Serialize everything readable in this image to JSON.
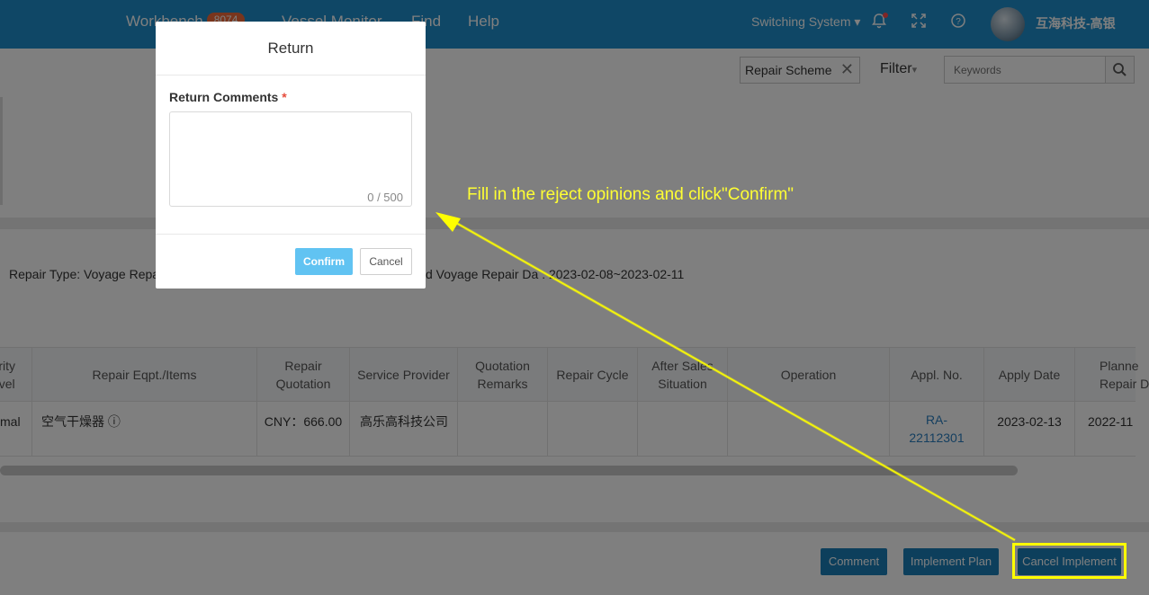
{
  "header": {
    "nav": [
      {
        "label": "Workbench",
        "badge": "8074"
      },
      {
        "label": "Vessel Monitor"
      },
      {
        "label": "Find"
      },
      {
        "label": "Help"
      }
    ],
    "switch_label": "Switching System",
    "user_name": "互海科技-高银",
    "icons": [
      "bell-icon",
      "fullscreen-icon",
      "help-icon"
    ]
  },
  "toolbar": {
    "tag_label": "Repair Scheme",
    "filter_label": "Filter",
    "search_placeholder": "Keywords"
  },
  "summary": {
    "repair_type": "Repair Type: Voyage Repa",
    "planned_date": "d Voyage Repair Da  : 2023-02-08~2023-02-11"
  },
  "table": {
    "headers": [
      "rity\nvel",
      "Repair Eqpt./Items",
      "Repair\nQuotation",
      "Service Provider",
      "Quotation\nRemarks",
      "Repair Cycle",
      "After Sales\nSituation",
      "Operation",
      "Appl. No.",
      "Apply Date",
      "Planne\nRepair D"
    ],
    "rows": [
      {
        "level": "mal",
        "item": "空气干燥器 ⓘ",
        "quotation": "CNY：666.00",
        "provider": "高乐高科技公司",
        "remarks": "",
        "cycle": "",
        "after_sales": "",
        "operation": "",
        "appl_no": "RA-\n22112301",
        "apply_date": "2023-02-13",
        "planned": "2022-11"
      }
    ]
  },
  "footer": {
    "comment_label": "Comment",
    "implement_plan_label": "Implement Plan",
    "cancel_implement_label": "Cancel Implement"
  },
  "modal": {
    "title": "Return",
    "field_label": "Return Comments",
    "required_mark": "*",
    "textarea_value": "",
    "counter": "0 / 500",
    "confirm_label": "Confirm",
    "cancel_label": "Cancel"
  },
  "annotation": {
    "text": "Fill in the reject opinions and click\"Confirm\"",
    "color": "#ffff00"
  },
  "colors": {
    "header_bg": "#1e8fcc",
    "primary_button": "#1a7fb8",
    "confirm_button": "#61c3f2",
    "badge": "#f26b3a"
  }
}
